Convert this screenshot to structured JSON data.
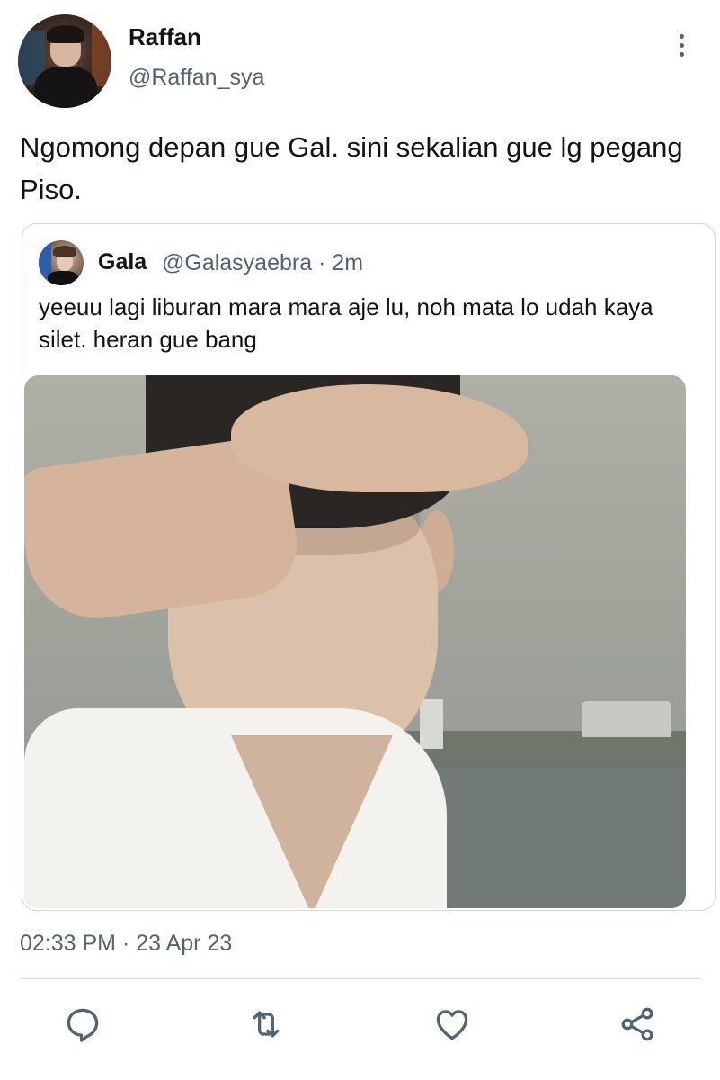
{
  "tweet": {
    "author": {
      "display_name": "Raffan",
      "handle": "@Raffan_sya"
    },
    "text": "Ngomong depan gue Gal. sini sekalian gue lg pegang Piso.",
    "timestamp": "02:33 PM · 23 Apr 23",
    "menu_icon": "more-vertical-icon"
  },
  "quoted_tweet": {
    "author": {
      "display_name": "Gala"
    },
    "meta": "@Galasyaebra · 2m",
    "text": "yeeuu lagi liburan mara mara aje lu, noh mata lo udah kaya silet. heran gue bang"
  },
  "actions": [
    {
      "icon": "reply-icon"
    },
    {
      "icon": "retweet-icon"
    },
    {
      "icon": "like-icon"
    },
    {
      "icon": "share-icon"
    }
  ],
  "colors": {
    "text_primary": "#0f1419",
    "text_secondary": "#536471",
    "border": "#cfd9de"
  }
}
